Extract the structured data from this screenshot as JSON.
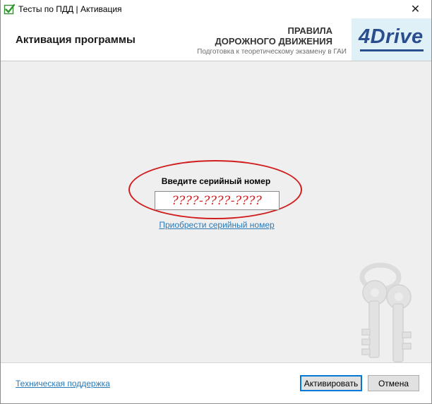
{
  "window": {
    "title": "Тесты по ПДД | Активация",
    "close_glyph": "✕"
  },
  "header": {
    "title": "Активация программы",
    "rules_line1": "ПРАВИЛА",
    "rules_line2": "ДОРОЖНОГО ДВИЖЕНИЯ",
    "subtitle": "Подготовка к теоретическому экзамену в ГАИ",
    "logo_text": "4Drive"
  },
  "main": {
    "serial_label": "Введите серийный номер",
    "serial_value": "",
    "serial_placeholder": "????-????-????",
    "buy_link": "Приобрести серийный номер"
  },
  "footer": {
    "support_link": "Техническая поддержка",
    "activate_label": "Активировать",
    "cancel_label": "Отмена"
  },
  "colors": {
    "accent_red": "#d11e1e",
    "link_blue": "#2a7ab8",
    "logo_blue": "#2a4d8e",
    "logo_bg": "#dff1f7",
    "main_bg": "#efefef",
    "focus_border": "#0078d7"
  },
  "icons": {
    "app": "checkbox-check-icon",
    "close": "close-icon",
    "decor": "keys-icon"
  }
}
